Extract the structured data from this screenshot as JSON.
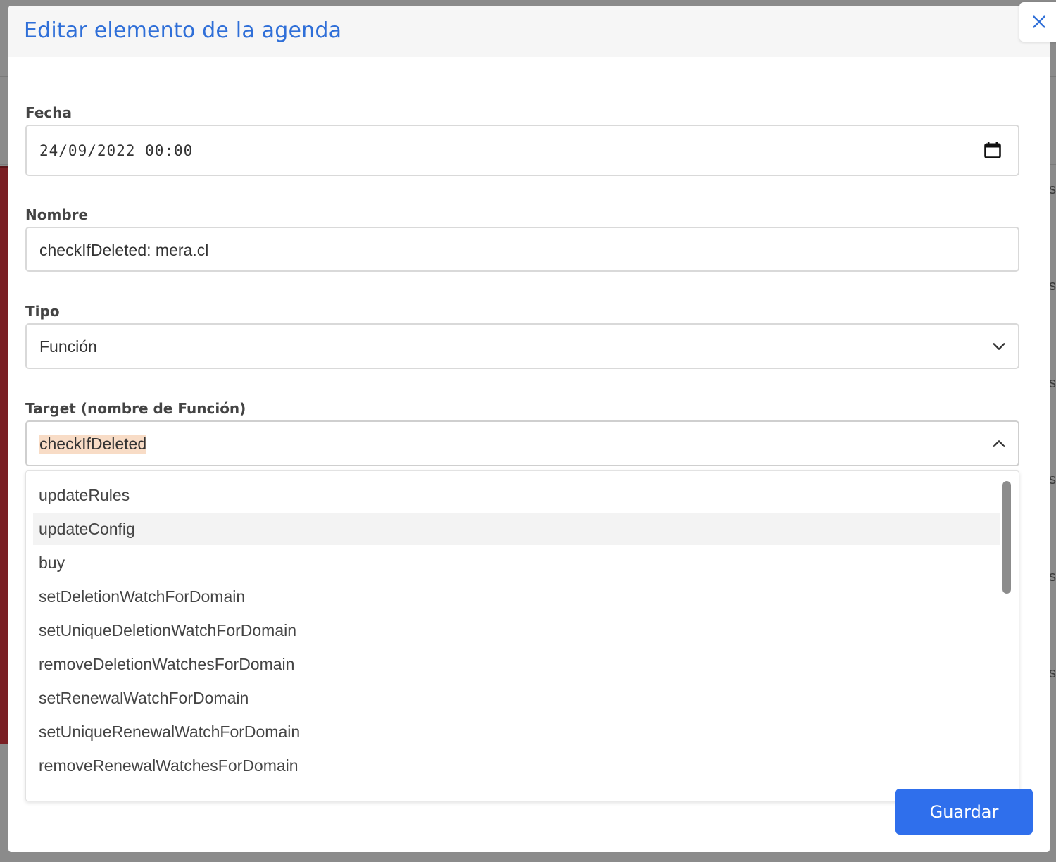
{
  "modal": {
    "title": "Editar elemento de la agenda",
    "close_icon": "close-icon"
  },
  "form": {
    "fecha": {
      "label": "Fecha",
      "value": "24/09/2022  00:00",
      "icon": "calendar-icon"
    },
    "nombre": {
      "label": "Nombre",
      "value": "checkIfDeleted: mera.cl"
    },
    "tipo": {
      "label": "Tipo",
      "value": "Función",
      "icon": "chevron-down-icon"
    },
    "target": {
      "label": "Target (nombre de Función)",
      "value": "checkIfDeleted",
      "icon": "chevron-up-icon"
    }
  },
  "dropdown": {
    "options": [
      "updateRules",
      "updateConfig",
      "buy",
      "setDeletionWatchForDomain",
      "setUniqueDeletionWatchForDomain",
      "removeDeletionWatchesForDomain",
      "setRenewalWatchForDomain",
      "setUniqueRenewalWatchForDomain",
      "removeRenewalWatchesForDomain"
    ],
    "hovered": "updateConfig"
  },
  "actions": {
    "save_label": "Guardar"
  },
  "colors": {
    "accent": "#2f6fec",
    "title": "#2f6fd8",
    "highlight": "#f8dcc6"
  }
}
